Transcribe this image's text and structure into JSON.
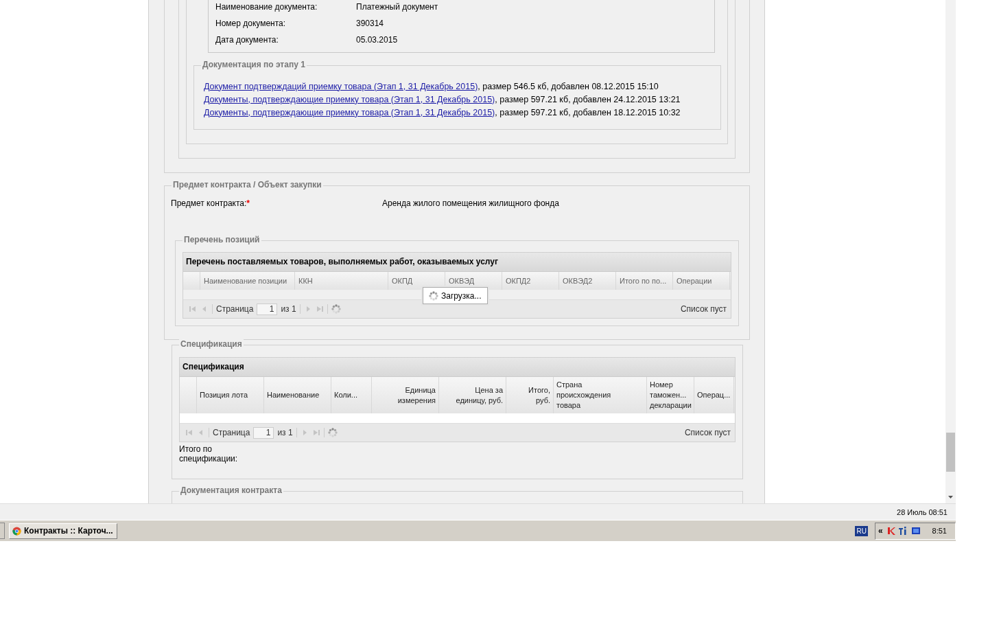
{
  "document": {
    "fields": [
      {
        "label": "Наименование документа:",
        "value": "Платежный документ"
      },
      {
        "label": "Номер документа:",
        "value": "390314"
      },
      {
        "label": "Дата документа:",
        "value": "05.03.2015"
      }
    ]
  },
  "stage_docs": {
    "legend": "Документация по этапу 1",
    "items": [
      {
        "link": "Документ подтверждаций приемку товара (Этап 1, 31 Декабрь 2015)",
        "details": ", размер 546.5 кб, добавлен 08.12.2015 15:10"
      },
      {
        "link": "Документы, подтверждающие приемку товара (Этап 1, 31 Декабрь 2015)",
        "details": ", размер 597.21 кб, добавлен 24.12.2015 13:21"
      },
      {
        "link": "Документы, подтверждающие приемку товара (Этап 1, 31 Декабрь 2015)",
        "details": ", размер 597.21 кб, добавлен 18.12.2015 10:32"
      }
    ]
  },
  "subject": {
    "legend": "Предмет контракта / Объект закупки",
    "label": "Предмет контракта:",
    "required": true,
    "required_mark": "*",
    "value": "Аренда жилого помещения жилищного фонда"
  },
  "positions": {
    "legend": "Перечень позиций",
    "title": "Перечень поставляемых товаров, выполняемых работ, оказываемых услуг",
    "columns": [
      "Наименование позиции",
      "ККН",
      "ОКПД",
      "ОКВЭД",
      "ОКПД2",
      "ОКВЭД2",
      "Итого по по...",
      "Операции"
    ],
    "pager": {
      "page_label": "Страница",
      "page": "1",
      "of": "из 1",
      "empty": "Список пуст"
    },
    "loading": "Загрузка..."
  },
  "specification": {
    "legend": "Спецификация",
    "title": "Спецификация",
    "columns": [
      "Позиция лота",
      "Наименование",
      "Коли...",
      "Единица измерения",
      "Цена за единицу, руб.",
      "Итого, руб.",
      "Страна происхождения товара",
      "Номер таможен... декларации",
      "Операц..."
    ],
    "pager": {
      "page_label": "Страница",
      "page": "1",
      "of": "из 1",
      "empty": "Список пуст"
    },
    "total_label": "Итого по спецификации:"
  },
  "contract_docs": {
    "legend": "Документация контракта"
  },
  "status_bar": {
    "datetime": "28 Июль 08:51"
  },
  "taskbar": {
    "task": "Контракты :: Карточ...",
    "language": "RU",
    "tray_chevron": "«",
    "clock": "8:51"
  }
}
